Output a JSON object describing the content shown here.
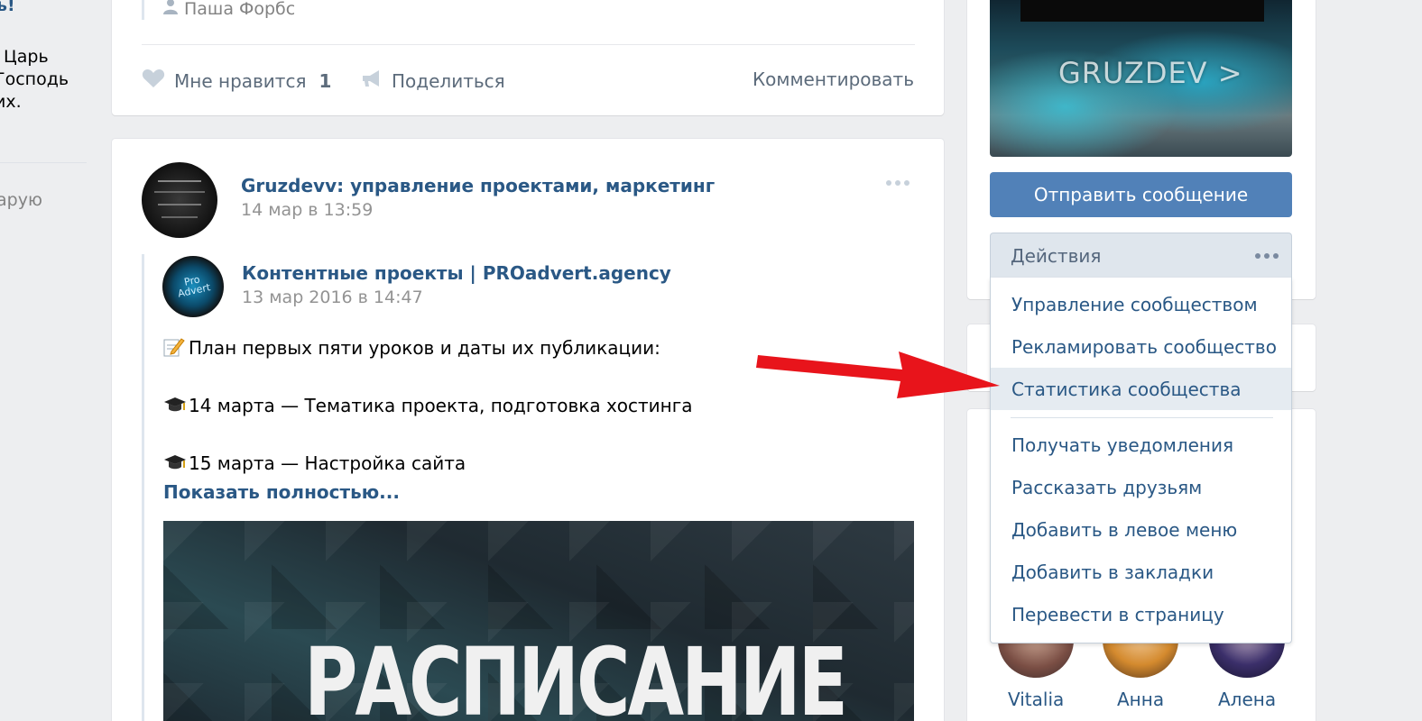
{
  "left": {
    "lines": [
      "ь!",
      "Царь",
      "Господь",
      "их."
    ],
    "gray_link": "арую"
  },
  "post1": {
    "author": "Паша Форбс",
    "like_label": "Мне нравится",
    "like_count": "1",
    "share_label": "Поделиться",
    "comment_label": "Комментировать"
  },
  "post2": {
    "group_name": "Gruzdevv: управление проектами, маркетинг",
    "date": "14 мар в 13:59",
    "repost": {
      "source_name": "Контентные проекты | PROadvert.agency",
      "date": "13 мар 2016 в 14:47",
      "avatar_text": "Pro Advert"
    },
    "lines": [
      "План первых пяти уроков и даты их публикации:",
      "14 марта — Тематика проекта, подготовка хостинга",
      "15 марта — Настройка сайта"
    ],
    "show_more": "Показать полностью...",
    "image_title": "РАСПИСАНИЕ"
  },
  "sidebar": {
    "cover_title": "GRUZDEV >",
    "send_message": "Отправить сообщение",
    "actions_label": "Действия",
    "menu": [
      "Управление сообществом",
      "Рекламировать сообщество",
      "Статистика сообщества",
      "Получать уведомления",
      "Рассказать друзьям",
      "Добавить в левое меню",
      "Добавить в закладки",
      "Перевести в страницу"
    ],
    "friends": [
      "Vitalia",
      "Анна",
      "Алена"
    ]
  },
  "colors": {
    "accent": "#5181b8",
    "link": "#2a5885",
    "arrow": "#e8141b",
    "background": "#edeef0"
  }
}
